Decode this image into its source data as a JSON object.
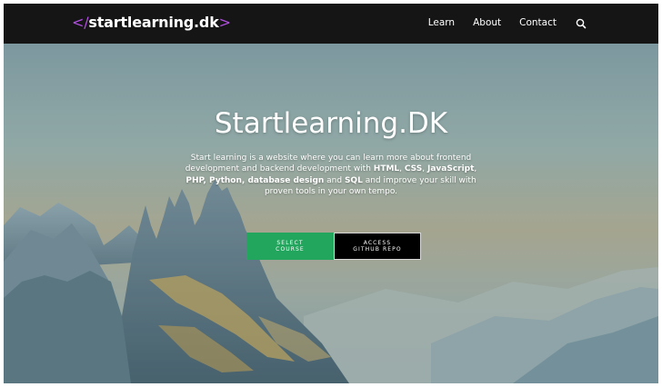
{
  "navbar": {
    "brand_open": "</",
    "brand_name": "startlearning.dk",
    "brand_close": ">",
    "links": [
      {
        "label": "Learn"
      },
      {
        "label": "About"
      },
      {
        "label": "Contact"
      }
    ],
    "search_icon": "search-icon"
  },
  "hero": {
    "title": "Startlearning.DK",
    "description": {
      "p1": "Start learning is a website where you can learn more about frontend development and backend development with ",
      "html": "HTML",
      "sep1": ", ",
      "css": "CSS",
      "sep2": ", ",
      "js": "JavaScript",
      "sep3": ", ",
      "php_python_db": "PHP, Python, database design",
      "sep4": " and ",
      "sql": "SQL",
      "p2": " and improve your skill with proven tools in your own tempo."
    },
    "buttons": {
      "select_line1": "SELECT",
      "select_line2": "COURSE",
      "github_line1": "ACCESS",
      "github_line2": "GITHUB REPO"
    }
  },
  "colors": {
    "navbar_bg": "#151515",
    "brand_accent": "#b14fe0",
    "select_button": "#22a55c",
    "github_button": "#000000"
  }
}
